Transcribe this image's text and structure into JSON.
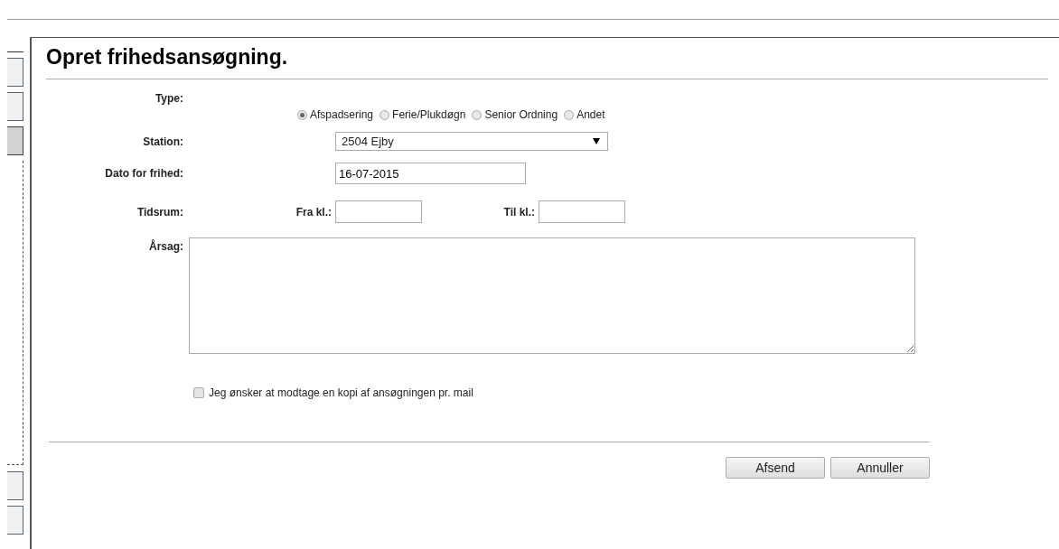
{
  "sidebar": {
    "buttons": [
      {
        "selected": false
      },
      {
        "selected": false
      },
      {
        "selected": true
      },
      {
        "selected": false
      },
      {
        "selected": false
      }
    ]
  },
  "dialog": {
    "title": "Opret frihedsansøgning.",
    "type": {
      "label": "Type:",
      "options": [
        {
          "label": "Afspadsering",
          "selected": true
        },
        {
          "label": "Ferie/Plukdøgn",
          "selected": false
        },
        {
          "label": "Senior Ordning",
          "selected": false
        },
        {
          "label": "Andet",
          "selected": false
        }
      ]
    },
    "station": {
      "label": "Station:",
      "value": "2504 Ejby"
    },
    "date": {
      "label": "Dato for frihed:",
      "value": "16-07-2015"
    },
    "time_range": {
      "label": "Tidsrum:",
      "from_label": "Fra kl.:",
      "to_label": "Til kl.:"
    },
    "reason": {
      "label": "Årsag:"
    },
    "copy_mail": {
      "label": "Jeg ønsker at modtage en kopi af ansøgningen pr. mail",
      "checked": false
    },
    "buttons": [
      "Afsend",
      "Annuller"
    ]
  }
}
